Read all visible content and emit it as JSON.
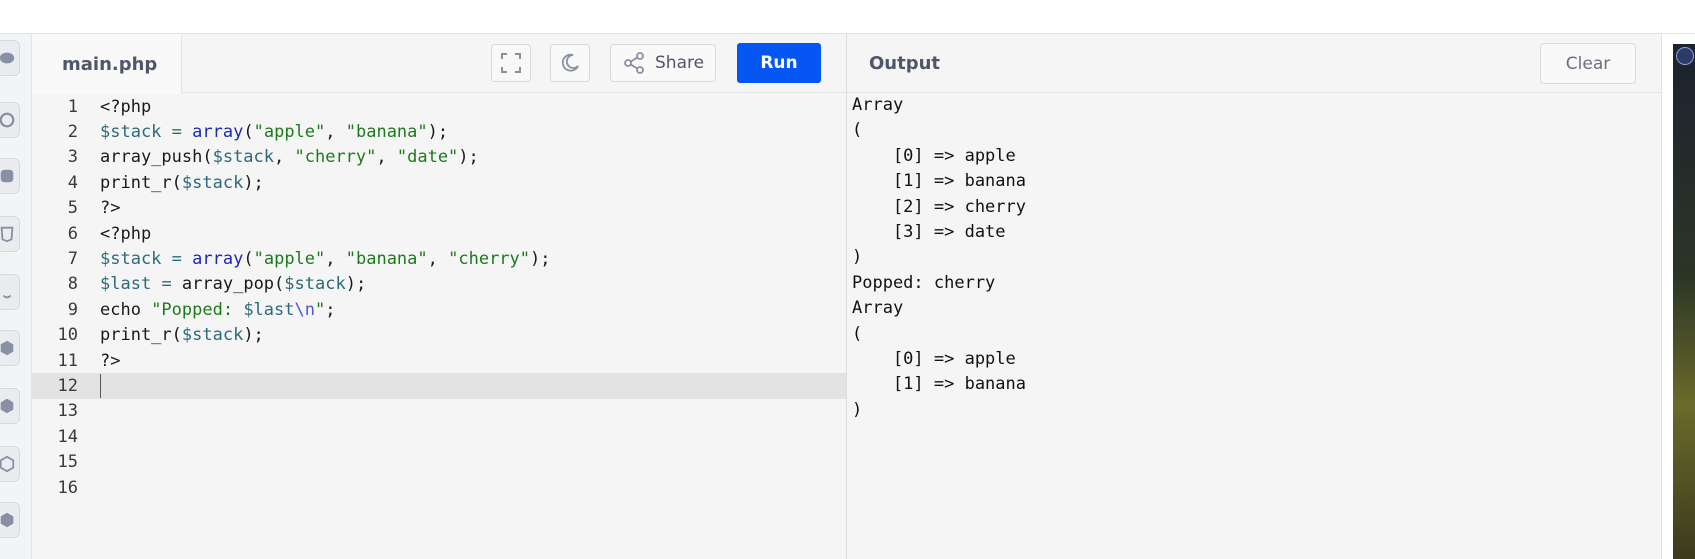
{
  "editor": {
    "file_tab": "main.php",
    "share_label": "Share",
    "run_label": "Run",
    "fullscreen_icon": "fullscreen-icon",
    "theme_icon": "moon-icon",
    "share_icon": "share-icon",
    "code_lines": [
      {
        "n": "1",
        "tokens": [
          [
            "plain",
            "<?php"
          ]
        ]
      },
      {
        "n": "2",
        "tokens": [
          [
            "var",
            "$stack"
          ],
          [
            "plain",
            " "
          ],
          [
            "var",
            "="
          ],
          [
            "plain",
            " "
          ],
          [
            "fn",
            "array"
          ],
          [
            "plain",
            "("
          ],
          [
            "str",
            "\"apple\""
          ],
          [
            "plain",
            ", "
          ],
          [
            "str",
            "\"banana\""
          ],
          [
            "plain",
            ");"
          ]
        ]
      },
      {
        "n": "3",
        "tokens": [
          [
            "plain",
            "array_push("
          ],
          [
            "var",
            "$stack"
          ],
          [
            "plain",
            ", "
          ],
          [
            "str",
            "\"cherry\""
          ],
          [
            "plain",
            ", "
          ],
          [
            "str",
            "\"date\""
          ],
          [
            "plain",
            ");"
          ]
        ]
      },
      {
        "n": "4",
        "tokens": [
          [
            "plain",
            "print_r("
          ],
          [
            "var",
            "$stack"
          ],
          [
            "plain",
            ");"
          ]
        ]
      },
      {
        "n": "5",
        "tokens": [
          [
            "plain",
            "?>"
          ]
        ]
      },
      {
        "n": "6",
        "tokens": [
          [
            "plain",
            "<?php"
          ]
        ]
      },
      {
        "n": "7",
        "tokens": [
          [
            "var",
            "$stack"
          ],
          [
            "plain",
            " "
          ],
          [
            "var",
            "="
          ],
          [
            "plain",
            " "
          ],
          [
            "fn",
            "array"
          ],
          [
            "plain",
            "("
          ],
          [
            "str",
            "\"apple\""
          ],
          [
            "plain",
            ", "
          ],
          [
            "str",
            "\"banana\""
          ],
          [
            "plain",
            ", "
          ],
          [
            "str",
            "\"cherry\""
          ],
          [
            "plain",
            ");"
          ]
        ]
      },
      {
        "n": "8",
        "tokens": [
          [
            "var",
            "$last"
          ],
          [
            "plain",
            " "
          ],
          [
            "var",
            "="
          ],
          [
            "plain",
            " array_pop("
          ],
          [
            "var",
            "$stack"
          ],
          [
            "plain",
            ");"
          ]
        ]
      },
      {
        "n": "9",
        "tokens": [
          [
            "plain",
            "echo "
          ],
          [
            "str",
            "\"Popped: "
          ],
          [
            "var",
            "$last"
          ],
          [
            "esc",
            "\\n"
          ],
          [
            "str",
            "\""
          ],
          [
            "plain",
            ";"
          ]
        ]
      },
      {
        "n": "10",
        "tokens": [
          [
            "plain",
            "print_r("
          ],
          [
            "var",
            "$stack"
          ],
          [
            "plain",
            ");"
          ]
        ]
      },
      {
        "n": "11",
        "tokens": [
          [
            "plain",
            "?>"
          ]
        ]
      },
      {
        "n": "12",
        "tokens": [],
        "active": true
      },
      {
        "n": "13",
        "tokens": []
      },
      {
        "n": "14",
        "tokens": []
      },
      {
        "n": "15",
        "tokens": []
      },
      {
        "n": "16",
        "tokens": []
      }
    ]
  },
  "output": {
    "title": "Output",
    "clear_label": "Clear",
    "lines": [
      "Array",
      "(",
      "    [0] => apple",
      "    [1] => banana",
      "    [2] => cherry",
      "    [3] => date",
      ")",
      "Popped: cherry",
      "Array",
      "(",
      "    [0] => apple",
      "    [1] => banana",
      ")"
    ]
  },
  "colors": {
    "run_button": "#0556f3",
    "variable": "#2b6a7a",
    "function": "#1a28b8",
    "string": "#1d7a1d",
    "active_line": "#e3e3e3"
  }
}
